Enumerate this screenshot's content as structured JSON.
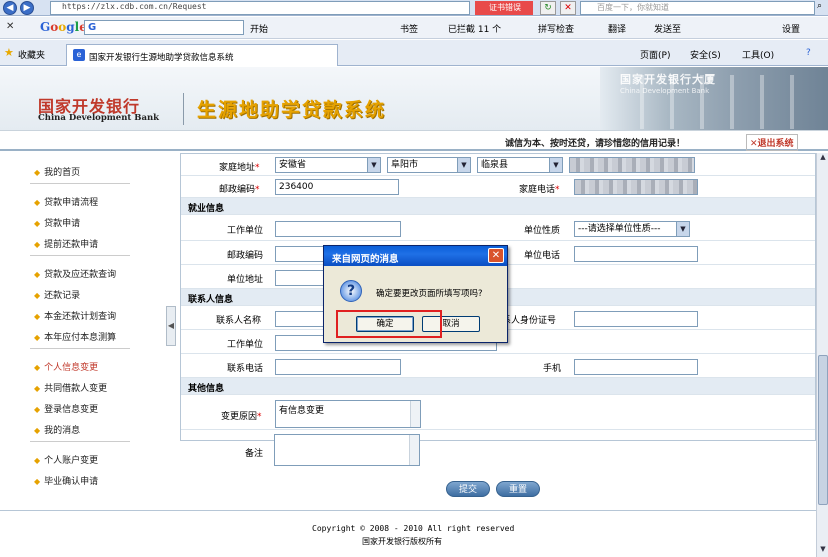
{
  "browser": {
    "address": "https://zlx.cdb.com.cn/Request",
    "cert_error": "证书错误",
    "search_placeholder": "百度一下，你就知道",
    "google_label": "Google",
    "google_search_value": "G",
    "google_tools": [
      "开始",
      "书签",
      "已拦截 11 个",
      "拼写检查",
      "翻译",
      "发送至"
    ],
    "settings_label": "设置",
    "favorites_label": "收藏夹",
    "tab_title": "国家开发银行生源地助学贷款信息系统",
    "cmd_tools": [
      "页面(P)",
      "安全(S)",
      "工具(O)"
    ]
  },
  "site": {
    "bank_cn": "国家开发银行",
    "bank_en": "China Development Bank",
    "system_name": "生源地助学贷款系统",
    "building_text": "国家开发银行大厦",
    "building_en": "China Development Bank",
    "motto": "诚信为本、按时还贷，请珍惜您的信用记录！",
    "logout": "退出系统"
  },
  "sidebar": {
    "items": [
      "我的首页",
      "贷款申请流程",
      "贷款申请",
      "提前还款申请",
      "贷款及应还款查询",
      "还款记录",
      "本金还款计划查询",
      "本年应付本息测算",
      "个人信息变更",
      "共同借款人变更",
      "登录信息变更",
      "我的消息",
      "个人账户变更",
      "毕业确认申请"
    ],
    "active_index": 8
  },
  "form": {
    "home_address_label": "家庭地址",
    "province": "安徽省",
    "city": "阜阳市",
    "county": "临泉县",
    "postcode_label": "邮政编码",
    "postcode_value": "236400",
    "home_phone_label": "家庭电话",
    "employment_section": "就业信息",
    "work_unit_label": "工作单位",
    "unit_nature_label": "单位性质",
    "unit_nature_value": "---请选择单位性质---",
    "emp_postcode_label": "邮政编码",
    "unit_phone_label": "单位电话",
    "unit_address_label": "单位地址",
    "contact_section": "联系人信息",
    "contact_name_label": "联系人名称",
    "contact_id_label": "联系人身份证号",
    "contact_work_label": "工作单位",
    "contact_phone_label": "联系电话",
    "mobile_label": "手机",
    "other_section": "其他信息",
    "reason_label": "变更原因",
    "reason_value": "有信息变更",
    "remark_label": "备注",
    "submit": "提交",
    "reset": "重置"
  },
  "dialog": {
    "title": "来自网页的消息",
    "message": "确定要更改页面所填写项吗?",
    "ok": "确定",
    "cancel": "取消"
  },
  "footer": {
    "copyright": "Copyright © 2008 - 2010 All right reserved",
    "owner": "国家开发银行版权所有"
  }
}
